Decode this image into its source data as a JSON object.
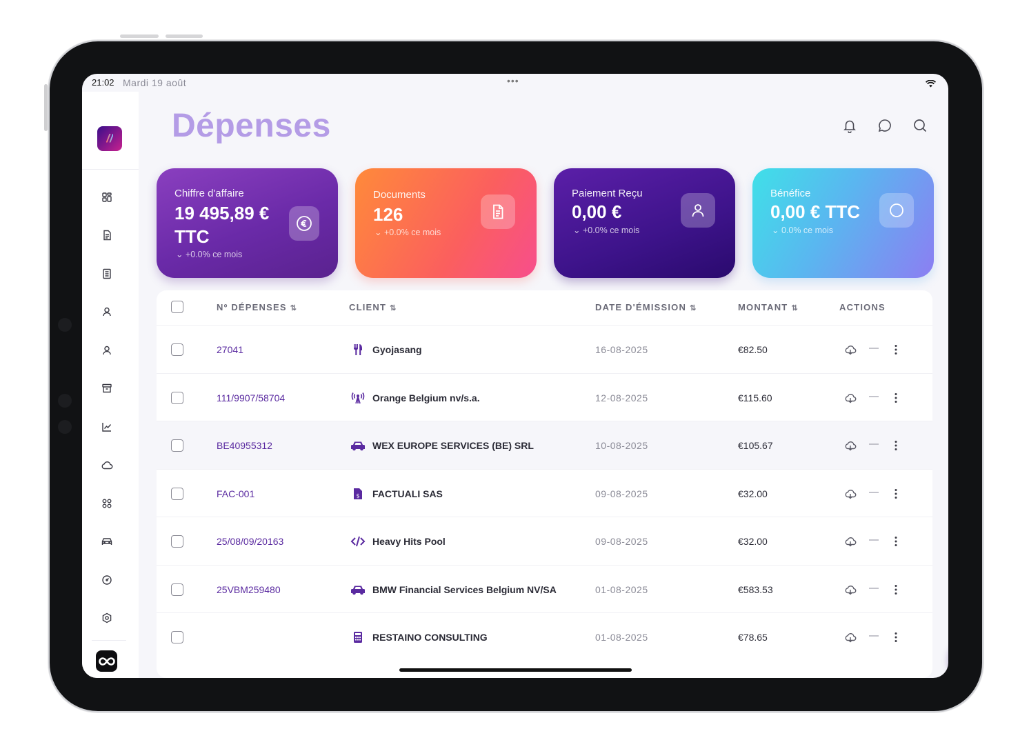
{
  "status_bar": {
    "time": "21:02",
    "date": "Mardi 19 août"
  },
  "page": {
    "title": "Dépenses"
  },
  "colors": {
    "brand": "#4a1a8a",
    "link": "#5a2aa0",
    "title": "#b49ce6"
  },
  "sidebar": {
    "items": [
      {
        "icon": "dashboard-icon"
      },
      {
        "icon": "document-icon"
      },
      {
        "icon": "list-document-icon"
      },
      {
        "icon": "user-icon"
      },
      {
        "icon": "user-alt-icon"
      },
      {
        "icon": "archive-icon"
      },
      {
        "icon": "chart-icon"
      },
      {
        "icon": "cloud-icon"
      },
      {
        "icon": "apps-icon"
      },
      {
        "icon": "car-icon"
      },
      {
        "icon": "gauge-icon"
      },
      {
        "icon": "settings-icon"
      }
    ]
  },
  "header_icons": [
    "bell-icon",
    "chat-icon",
    "search-icon"
  ],
  "cards": [
    {
      "label": "Chiffre d'affaire",
      "value": "19 495,89 €",
      "value2": "TTC",
      "trend": "+0.0% ce mois",
      "icon": "euro-icon"
    },
    {
      "label": "Documents",
      "value": "126",
      "trend": "+0.0% ce mois",
      "icon": "document-icon"
    },
    {
      "label": "Paiement Reçu",
      "value": "0,00 €",
      "trend": "+0.0% ce mois",
      "icon": "user-icon"
    },
    {
      "label": "Bénéfice",
      "value": "0,00 € TTC",
      "trend": "0.0% ce mois",
      "icon": "circle-icon"
    }
  ],
  "table": {
    "headers": {
      "number": "Nº DÉPENSES",
      "client": "CLIENT",
      "date": "DATE D'ÉMISSION",
      "amount": "MONTANT",
      "actions": "ACTIONS"
    },
    "rows": [
      {
        "number": "27041",
        "client": "Gyojasang",
        "icon": "restaurant-icon",
        "date": "16-08-2025",
        "amount": "€82.50"
      },
      {
        "number": "111/9907/58704",
        "client": "Orange Belgium nv/s.a.",
        "icon": "antenna-icon",
        "date": "12-08-2025",
        "amount": "€115.60"
      },
      {
        "number": "BE40955312",
        "client": "WEX EUROPE SERVICES (BE) SRL",
        "icon": "car-icon",
        "date": "10-08-2025",
        "amount": "€105.67"
      },
      {
        "number": "FAC-001",
        "client": "FACTUALI SAS",
        "icon": "invoice-icon",
        "date": "09-08-2025",
        "amount": "€32.00"
      },
      {
        "number": "25/08/09/20163",
        "client": "Heavy Hits Pool",
        "icon": "code-icon",
        "date": "09-08-2025",
        "amount": "€32.00"
      },
      {
        "number": "25VBM259480",
        "client": "BMW Financial Services Belgium NV/SA",
        "icon": "car-icon",
        "date": "01-08-2025",
        "amount": "€583.53"
      },
      {
        "number": "",
        "client": "RESTAINO CONSULTING",
        "icon": "calculator-icon",
        "date": "01-08-2025",
        "amount": "€78.65"
      }
    ]
  }
}
